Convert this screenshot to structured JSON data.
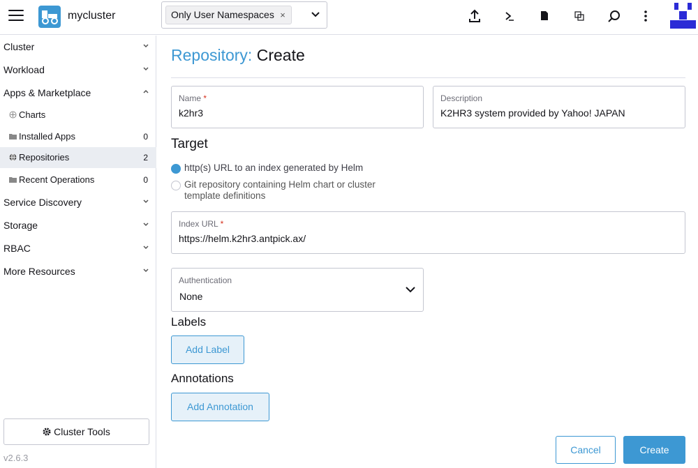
{
  "header": {
    "cluster_name": "mycluster",
    "namespace_filter": {
      "chip_label": "Only User Namespaces",
      "chip_remove": "×"
    },
    "icons": [
      "import-yaml-icon",
      "kubectl-shell-icon",
      "kubeconfig-download-icon",
      "copy-kubeconfig-icon",
      "resource-search-icon",
      "more-actions-icon"
    ]
  },
  "sidebar": {
    "groups": [
      {
        "label": "Cluster",
        "expanded": false
      },
      {
        "label": "Workload",
        "expanded": false
      },
      {
        "label": "Apps & Marketplace",
        "expanded": true,
        "items": [
          {
            "label": "Charts",
            "count": ""
          },
          {
            "label": "Installed Apps",
            "count": "0"
          },
          {
            "label": "Repositories",
            "count": "2",
            "active": true
          },
          {
            "label": "Recent Operations",
            "count": "0"
          }
        ]
      },
      {
        "label": "Service Discovery",
        "expanded": false
      },
      {
        "label": "Storage",
        "expanded": false
      },
      {
        "label": "RBAC",
        "expanded": false
      },
      {
        "label": "More Resources",
        "expanded": false
      }
    ],
    "cluster_tools": "Cluster Tools",
    "version": "v2.6.3"
  },
  "main": {
    "title_crumb": "Repository:",
    "title_action": "Create",
    "name_field": {
      "label": "Name",
      "required_mark": "*",
      "value": "k2hr3"
    },
    "description_field": {
      "label": "Description",
      "value": "K2HR3 system provided by Yahoo! JAPAN"
    },
    "target": {
      "heading": "Target",
      "options": [
        {
          "label": "http(s) URL to an index generated by Helm",
          "selected": true
        },
        {
          "label": "Git repository containing Helm chart or cluster template definitions",
          "selected": false
        }
      ]
    },
    "index_url_field": {
      "label": "Index URL",
      "required_mark": "*",
      "value": "https://helm.k2hr3.antpick.ax/"
    },
    "authentication": {
      "label": "Authentication",
      "value": "None"
    },
    "labels": {
      "heading": "Labels",
      "add_button": "Add Label"
    },
    "annotations": {
      "heading": "Annotations",
      "add_button": "Add Annotation"
    },
    "cancel_button": "Cancel",
    "create_button": "Create"
  },
  "colors": {
    "accent": "#3d98d3",
    "required": "#d6301d",
    "active_bg": "#eaedf2"
  }
}
